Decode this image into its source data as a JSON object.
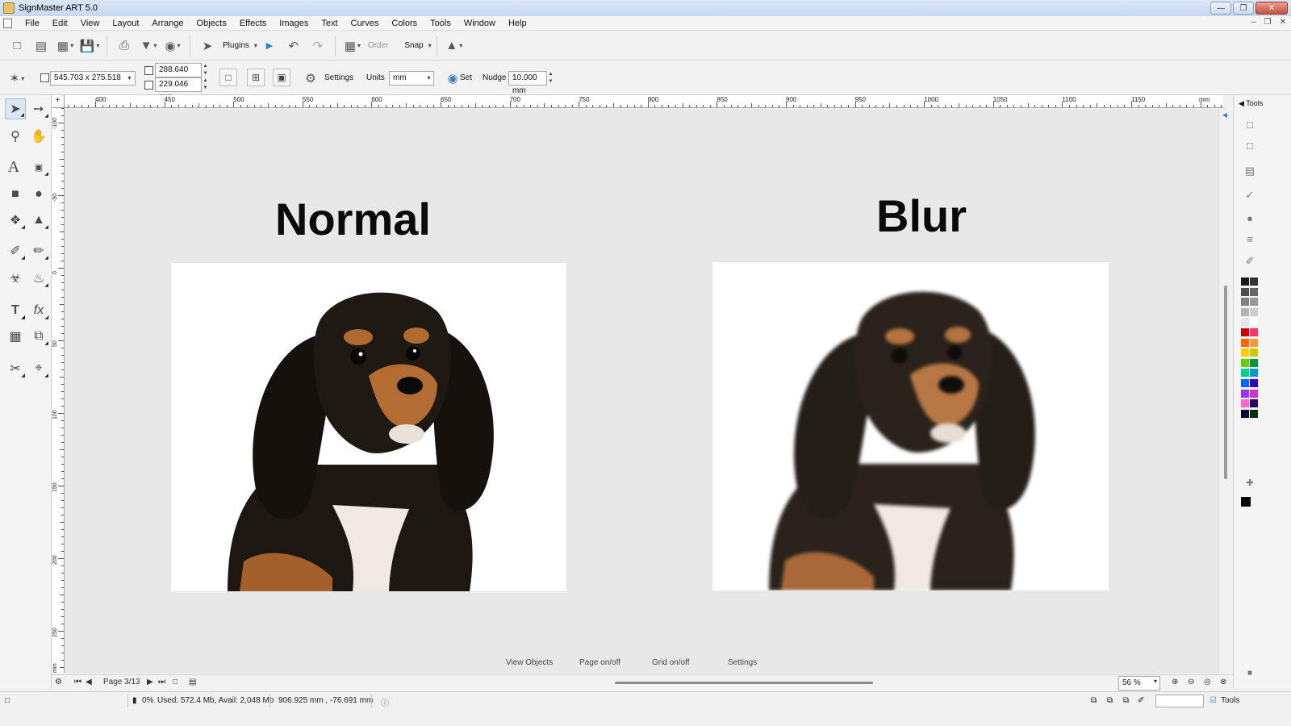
{
  "window": {
    "title": "SignMaster ART 5.0"
  },
  "menu": [
    "File",
    "Edit",
    "View",
    "Layout",
    "Arrange",
    "Objects",
    "Effects",
    "Images",
    "Text",
    "Curves",
    "Colors",
    "Tools",
    "Window",
    "Help"
  ],
  "toolbar": {
    "plugins_label": "Plugins",
    "order_label": "Order",
    "snap_label": "Snap"
  },
  "properties": {
    "size_value": "545.703 x 275.518",
    "width_value": "288.640 mm",
    "height_value": "229.046 mm",
    "settings_label": "Settings",
    "units_label": "Units",
    "units_value": "mm",
    "set_label": "Set",
    "nudge_label": "Nudge",
    "nudge_value": "10.000 mm"
  },
  "ruler": {
    "h_labels": [
      "400",
      "450",
      "500",
      "550",
      "600",
      "650",
      "700",
      "750",
      "800",
      "850",
      "900",
      "950",
      "1000",
      "1050",
      "1100",
      "1150",
      "mm"
    ],
    "v_labels": [
      "-100",
      "-50",
      "0",
      "50",
      "100",
      "150",
      "200",
      "250",
      "mm"
    ]
  },
  "canvas": {
    "left_heading": "Normal",
    "right_heading": "Blur",
    "links": [
      "View Objects",
      "Page on/off",
      "Grid on/off",
      "Settings"
    ]
  },
  "right_panel": {
    "header": "Tools"
  },
  "page_nav": {
    "page_label": "Page 3/13",
    "zoom_value": "56 %"
  },
  "status": {
    "progress": "0%",
    "memory": "Used: 572.4 Mb, Avail: 2,048 Mb",
    "coordinates": "906.925 mm , -76.691 mm",
    "tools_label": "Tools"
  },
  "colors": {
    "palette": [
      "#1a1a1a",
      "#333333",
      "#4d4d4d",
      "#666666",
      "#808080",
      "#999999",
      "#b3b3b3",
      "#cccccc",
      "#e6e6e6",
      "#ffffff",
      "#cc0000",
      "#ff3366",
      "#ff6600",
      "#ff9933",
      "#ffcc00",
      "#cccc00",
      "#66cc00",
      "#009933",
      "#00cc99",
      "#0099cc",
      "#0066ff",
      "#3300cc",
      "#9933ff",
      "#cc33cc",
      "#ff66cc",
      "#330066",
      "#000033",
      "#003300"
    ]
  }
}
